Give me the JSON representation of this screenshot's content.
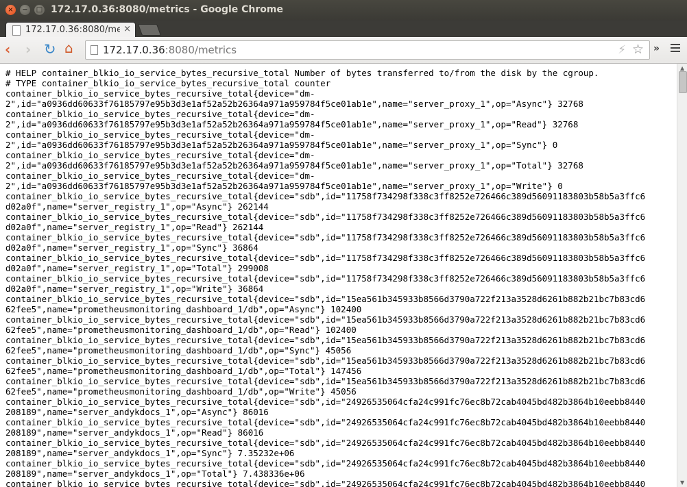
{
  "window": {
    "title": "172.17.0.36:8080/metrics - Google Chrome",
    "controls": {
      "close": "×",
      "minimize": "−",
      "maximize": "□"
    }
  },
  "tab": {
    "title": "172.17.0.36:8080/me",
    "close": "×"
  },
  "toolbar": {
    "back": "‹",
    "forward": "›",
    "reload": "↻",
    "home": "⌂",
    "url_host": "172.17.0.36",
    "url_rest": ":8080/metrics",
    "bolt": "⚡",
    "star": "☆",
    "extensions": "»"
  },
  "content": {
    "lines": [
      "# HELP container_blkio_io_service_bytes_recursive_total Number of bytes transferred to/from the disk by the cgroup.",
      "# TYPE container_blkio_io_service_bytes_recursive_total counter",
      "container_blkio_io_service_bytes_recursive_total{device=\"dm-",
      "2\",id=\"a0936dd60633f76185797e95b3d3e1af52a52b26364a971a959784f5ce01ab1e\",name=\"server_proxy_1\",op=\"Async\"} 32768",
      "container_blkio_io_service_bytes_recursive_total{device=\"dm-",
      "2\",id=\"a0936dd60633f76185797e95b3d3e1af52a52b26364a971a959784f5ce01ab1e\",name=\"server_proxy_1\",op=\"Read\"} 32768",
      "container_blkio_io_service_bytes_recursive_total{device=\"dm-",
      "2\",id=\"a0936dd60633f76185797e95b3d3e1af52a52b26364a971a959784f5ce01ab1e\",name=\"server_proxy_1\",op=\"Sync\"} 0",
      "container_blkio_io_service_bytes_recursive_total{device=\"dm-",
      "2\",id=\"a0936dd60633f76185797e95b3d3e1af52a52b26364a971a959784f5ce01ab1e\",name=\"server_proxy_1\",op=\"Total\"} 32768",
      "container_blkio_io_service_bytes_recursive_total{device=\"dm-",
      "2\",id=\"a0936dd60633f76185797e95b3d3e1af52a52b26364a971a959784f5ce01ab1e\",name=\"server_proxy_1\",op=\"Write\"} 0",
      "container_blkio_io_service_bytes_recursive_total{device=\"sdb\",id=\"11758f734298f338c3ff8252e726466c389d56091183803b58b5a3ffc6",
      "d02a0f\",name=\"server_registry_1\",op=\"Async\"} 262144",
      "container_blkio_io_service_bytes_recursive_total{device=\"sdb\",id=\"11758f734298f338c3ff8252e726466c389d56091183803b58b5a3ffc6",
      "d02a0f\",name=\"server_registry_1\",op=\"Read\"} 262144",
      "container_blkio_io_service_bytes_recursive_total{device=\"sdb\",id=\"11758f734298f338c3ff8252e726466c389d56091183803b58b5a3ffc6",
      "d02a0f\",name=\"server_registry_1\",op=\"Sync\"} 36864",
      "container_blkio_io_service_bytes_recursive_total{device=\"sdb\",id=\"11758f734298f338c3ff8252e726466c389d56091183803b58b5a3ffc6",
      "d02a0f\",name=\"server_registry_1\",op=\"Total\"} 299008",
      "container_blkio_io_service_bytes_recursive_total{device=\"sdb\",id=\"11758f734298f338c3ff8252e726466c389d56091183803b58b5a3ffc6",
      "d02a0f\",name=\"server_registry_1\",op=\"Write\"} 36864",
      "container_blkio_io_service_bytes_recursive_total{device=\"sdb\",id=\"15ea561b345933b8566d3790a722f213a3528d6261b882b21bc7b83cd6",
      "62fee5\",name=\"prometheusmonitoring_dashboard_1/db\",op=\"Async\"} 102400",
      "container_blkio_io_service_bytes_recursive_total{device=\"sdb\",id=\"15ea561b345933b8566d3790a722f213a3528d6261b882b21bc7b83cd6",
      "62fee5\",name=\"prometheusmonitoring_dashboard_1/db\",op=\"Read\"} 102400",
      "container_blkio_io_service_bytes_recursive_total{device=\"sdb\",id=\"15ea561b345933b8566d3790a722f213a3528d6261b882b21bc7b83cd6",
      "62fee5\",name=\"prometheusmonitoring_dashboard_1/db\",op=\"Sync\"} 45056",
      "container_blkio_io_service_bytes_recursive_total{device=\"sdb\",id=\"15ea561b345933b8566d3790a722f213a3528d6261b882b21bc7b83cd6",
      "62fee5\",name=\"prometheusmonitoring_dashboard_1/db\",op=\"Total\"} 147456",
      "container_blkio_io_service_bytes_recursive_total{device=\"sdb\",id=\"15ea561b345933b8566d3790a722f213a3528d6261b882b21bc7b83cd6",
      "62fee5\",name=\"prometheusmonitoring_dashboard_1/db\",op=\"Write\"} 45056",
      "container_blkio_io_service_bytes_recursive_total{device=\"sdb\",id=\"24926535064cfa24c991fc76ec8b72cab4045bd482b3864b10eebb8440",
      "208189\",name=\"server_andykdocs_1\",op=\"Async\"} 86016",
      "container_blkio_io_service_bytes_recursive_total{device=\"sdb\",id=\"24926535064cfa24c991fc76ec8b72cab4045bd482b3864b10eebb8440",
      "208189\",name=\"server_andykdocs_1\",op=\"Read\"} 86016",
      "container_blkio_io_service_bytes_recursive_total{device=\"sdb\",id=\"24926535064cfa24c991fc76ec8b72cab4045bd482b3864b10eebb8440",
      "208189\",name=\"server_andykdocs_1\",op=\"Sync\"} 7.35232e+06",
      "container_blkio_io_service_bytes_recursive_total{device=\"sdb\",id=\"24926535064cfa24c991fc76ec8b72cab4045bd482b3864b10eebb8440",
      "208189\",name=\"server_andykdocs_1\",op=\"Total\"} 7.438336e+06",
      "container_blkio_io_service_bytes_recursive_total{device=\"sdb\",id=\"24926535064cfa24c991fc76ec8b72cab4045bd482b3864b10eebb8440"
    ]
  }
}
